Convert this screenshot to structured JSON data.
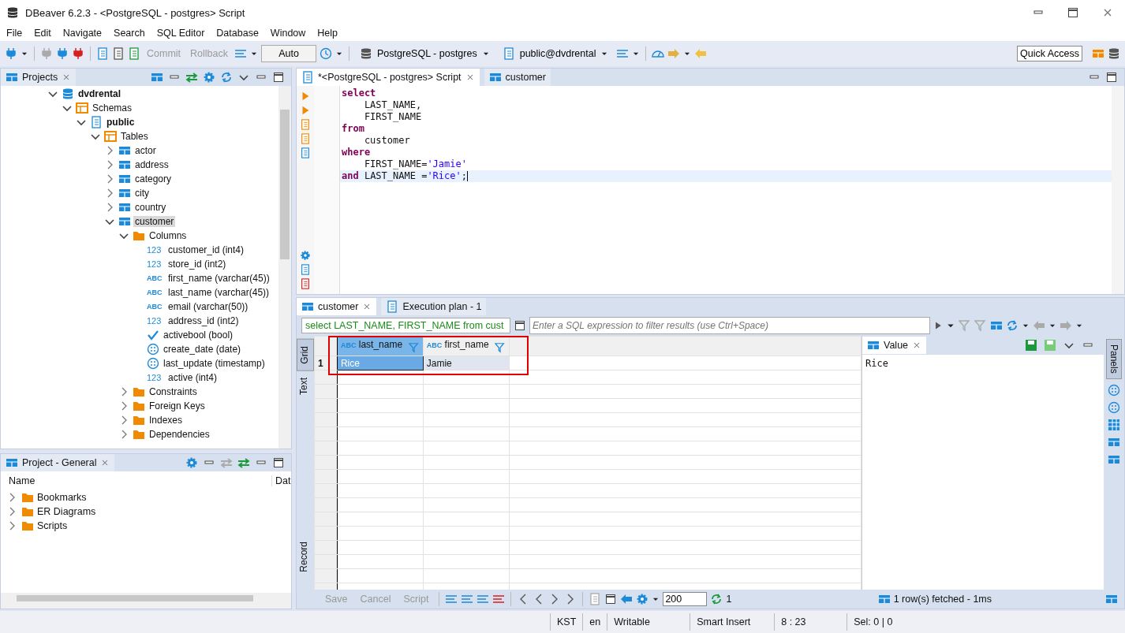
{
  "window": {
    "title": "DBeaver 6.2.3 - <PostgreSQL - postgres> Script"
  },
  "menu": [
    "File",
    "Edit",
    "Navigate",
    "Search",
    "SQL Editor",
    "Database",
    "Window",
    "Help"
  ],
  "toolbar": {
    "commit": {
      "label": "Commit",
      "disabled": true
    },
    "rollback": {
      "label": "Rollback",
      "disabled": true
    },
    "commit_mode": "Auto",
    "connection": "PostgreSQL - postgres",
    "schema": "public@dvdrental",
    "quick_access": "Quick Access"
  },
  "projects": {
    "title": "Projects",
    "tree": [
      {
        "label": "dvdrental",
        "kind": "database",
        "bold": true,
        "selected": false,
        "expanded": true,
        "children": [
          {
            "label": "Schemas",
            "kind": "schemas",
            "bold": false,
            "selected": false,
            "expanded": true,
            "children": [
              {
                "label": "public",
                "kind": "schema",
                "bold": true,
                "selected": false,
                "expanded": true,
                "children": [
                  {
                    "label": "Tables",
                    "kind": "tables",
                    "bold": false,
                    "selected": false,
                    "expanded": true,
                    "children": [
                      {
                        "label": "actor",
                        "kind": "table",
                        "bold": false,
                        "selected": false,
                        "expanded": false
                      },
                      {
                        "label": "address",
                        "kind": "table",
                        "bold": false,
                        "selected": false,
                        "expanded": false
                      },
                      {
                        "label": "category",
                        "kind": "table",
                        "bold": false,
                        "selected": false,
                        "expanded": false
                      },
                      {
                        "label": "city",
                        "kind": "table",
                        "bold": false,
                        "selected": false,
                        "expanded": false
                      },
                      {
                        "label": "country",
                        "kind": "table",
                        "bold": false,
                        "selected": false,
                        "expanded": false
                      },
                      {
                        "label": "customer",
                        "kind": "table",
                        "bold": false,
                        "selected": true,
                        "expanded": true,
                        "children": [
                          {
                            "label": "Columns",
                            "kind": "folder",
                            "bold": false,
                            "selected": false,
                            "expanded": true,
                            "children": [
                              {
                                "label": "customer_id (int4)",
                                "kind": "number",
                                "badge": "123",
                                "bold": false,
                                "selected": false
                              },
                              {
                                "label": "store_id (int2)",
                                "kind": "number",
                                "badge": "123",
                                "bold": false,
                                "selected": false
                              },
                              {
                                "label": "first_name (varchar(45))",
                                "kind": "text",
                                "badge": "ABC",
                                "bold": false,
                                "selected": false
                              },
                              {
                                "label": "last_name (varchar(45))",
                                "kind": "text",
                                "badge": "ABC",
                                "bold": false,
                                "selected": false
                              },
                              {
                                "label": "email (varchar(50))",
                                "kind": "text",
                                "badge": "ABC",
                                "bold": false,
                                "selected": false
                              },
                              {
                                "label": "address_id (int2)",
                                "kind": "number",
                                "badge": "123",
                                "bold": false,
                                "selected": false
                              },
                              {
                                "label": "activebool (bool)",
                                "kind": "bool",
                                "bold": false,
                                "selected": false
                              },
                              {
                                "label": "create_date (date)",
                                "kind": "date",
                                "bold": false,
                                "selected": false
                              },
                              {
                                "label": "last_update (timestamp)",
                                "kind": "date",
                                "bold": false,
                                "selected": false
                              },
                              {
                                "label": "active (int4)",
                                "kind": "number",
                                "badge": "123",
                                "bold": false,
                                "selected": false
                              }
                            ]
                          },
                          {
                            "label": "Constraints",
                            "kind": "folder",
                            "bold": false,
                            "selected": false,
                            "expanded": false
                          },
                          {
                            "label": "Foreign Keys",
                            "kind": "folder",
                            "bold": false,
                            "selected": false,
                            "expanded": false
                          },
                          {
                            "label": "Indexes",
                            "kind": "folder",
                            "bold": false,
                            "selected": false,
                            "expanded": false
                          },
                          {
                            "label": "Dependencies",
                            "kind": "folder",
                            "bold": false,
                            "selected": false,
                            "expanded": false
                          }
                        ]
                      }
                    ]
                  }
                ]
              }
            ]
          }
        ]
      }
    ]
  },
  "project_general": {
    "title": "Project - General",
    "columns": [
      "Name",
      "Dat"
    ],
    "items": [
      {
        "label": "Bookmarks",
        "expanded": false
      },
      {
        "label": "ER Diagrams",
        "expanded": false
      },
      {
        "label": "Scripts",
        "expanded": false
      }
    ]
  },
  "editor": {
    "tabs": [
      {
        "label": "*<PostgreSQL - postgres> Script",
        "selected": true
      },
      {
        "label": "customer",
        "selected": false
      }
    ],
    "lines": [
      {
        "current": false,
        "tokens": [
          {
            "kind": "keyword",
            "text": "select"
          }
        ]
      },
      {
        "current": false,
        "tokens": [
          {
            "kind": "plain",
            "text": "    LAST_NAME,"
          }
        ]
      },
      {
        "current": false,
        "tokens": [
          {
            "kind": "plain",
            "text": "    FIRST_NAME"
          }
        ]
      },
      {
        "current": false,
        "tokens": [
          {
            "kind": "keyword",
            "text": "from"
          }
        ]
      },
      {
        "current": false,
        "tokens": [
          {
            "kind": "plain",
            "text": "    customer"
          }
        ]
      },
      {
        "current": false,
        "tokens": [
          {
            "kind": "keyword",
            "text": "where"
          }
        ]
      },
      {
        "current": false,
        "tokens": [
          {
            "kind": "plain",
            "text": "    FIRST_NAME="
          },
          {
            "kind": "string",
            "text": "'Jamie'"
          }
        ]
      },
      {
        "current": true,
        "tokens": [
          {
            "kind": "keyword",
            "text": "and"
          },
          {
            "kind": "plain",
            "text": " LAST_NAME ="
          },
          {
            "kind": "string",
            "text": "'Rice'"
          },
          {
            "kind": "plain",
            "text": ";"
          }
        ]
      }
    ]
  },
  "results": {
    "tabs": [
      {
        "label": "customer",
        "selected": true
      },
      {
        "label": "Execution plan - 1",
        "selected": false
      }
    ],
    "query": "select LAST_NAME, FIRST_NAME from cust",
    "filter": {
      "placeholder": "Enter a SQL expression to filter results (use Ctrl+Space)"
    },
    "views": [
      {
        "label": "Grid",
        "selected": true
      },
      {
        "label": "Text",
        "selected": false
      },
      {
        "label": "Record",
        "selected": false
      }
    ],
    "columns": [
      {
        "badge": "ABC",
        "name": "last_name",
        "selected": true
      },
      {
        "badge": "ABC",
        "name": "first_name",
        "selected": false
      }
    ],
    "rows": [
      {
        "number": "1",
        "cells": [
          {
            "text": "Rice",
            "selected": true
          },
          {
            "text": "Jamie",
            "selected": false
          }
        ]
      }
    ],
    "value_panel": {
      "title": "Value",
      "content": "Rice"
    },
    "panels_tab": "Panels",
    "actions": [
      {
        "label": "Save",
        "disabled": true
      },
      {
        "label": "Cancel",
        "disabled": true
      },
      {
        "label": "Script",
        "disabled": true
      }
    ],
    "fetch_size": "200",
    "refresh_count": "1",
    "status": "1 row(s) fetched - 1ms"
  },
  "status_bar": [
    "KST",
    "en",
    "Writable",
    "Smart Insert",
    "8 : 23",
    "Sel: 0 | 0"
  ]
}
